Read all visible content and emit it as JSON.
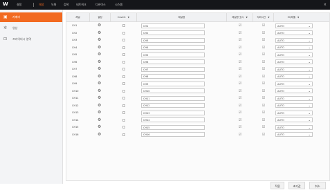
{
  "topbar": {
    "logo": "W",
    "menus": [
      "설정",
      "재생",
      "녹화",
      "검색",
      "네트워크",
      "디바이스",
      "시스템"
    ],
    "active_menu_index": 1,
    "close": "×"
  },
  "sidebar": {
    "items": [
      {
        "label": "카메라",
        "icon": "camera-icon",
        "active": true
      },
      {
        "label": "영상",
        "icon": "video-icon",
        "active": false
      },
      {
        "label": "프라이버시 영역",
        "icon": "privacy-icon",
        "active": false
      }
    ]
  },
  "table": {
    "headers": {
      "channel": "채널",
      "setting": "설정",
      "covert": "Covert",
      "name": "채널명",
      "display_name": "채널명 표시",
      "display_time": "녹화시간",
      "equalizer": "EQ레벨"
    },
    "rows": [
      {
        "ch": "CH1",
        "name": "CH1",
        "eq": "AUTO"
      },
      {
        "ch": "CH2",
        "name": "CH2",
        "eq": "AUTO"
      },
      {
        "ch": "CH3",
        "name": "CH3",
        "eq": "AUTO"
      },
      {
        "ch": "CH4",
        "name": "CH4",
        "eq": "AUTO"
      },
      {
        "ch": "CH5",
        "name": "CH5",
        "eq": "AUTO"
      },
      {
        "ch": "CH6",
        "name": "CH6",
        "eq": "AUTO"
      },
      {
        "ch": "CH7",
        "name": "CH7",
        "eq": "AUTO"
      },
      {
        "ch": "CH8",
        "name": "CH8",
        "eq": "AUTO"
      },
      {
        "ch": "CH9",
        "name": "CH9",
        "eq": "AUTO"
      },
      {
        "ch": "CH10",
        "name": "CH10",
        "eq": "AUTO"
      },
      {
        "ch": "CH11",
        "name": "CH11",
        "eq": "AUTO"
      },
      {
        "ch": "CH12",
        "name": "CH12",
        "eq": "AUTO"
      },
      {
        "ch": "CH13",
        "name": "CH13",
        "eq": "AUTO"
      },
      {
        "ch": "CH14",
        "name": "CH14",
        "eq": "AUTO"
      },
      {
        "ch": "CH15",
        "name": "CH15",
        "eq": "AUTO"
      },
      {
        "ch": "CH16",
        "name": "CH16",
        "eq": "AUTO"
      }
    ]
  },
  "footer": {
    "apply": "적용",
    "reset": "초기값",
    "cancel": "취소"
  },
  "colors": {
    "accent": "#f26a21",
    "topbar": "#15161a"
  }
}
